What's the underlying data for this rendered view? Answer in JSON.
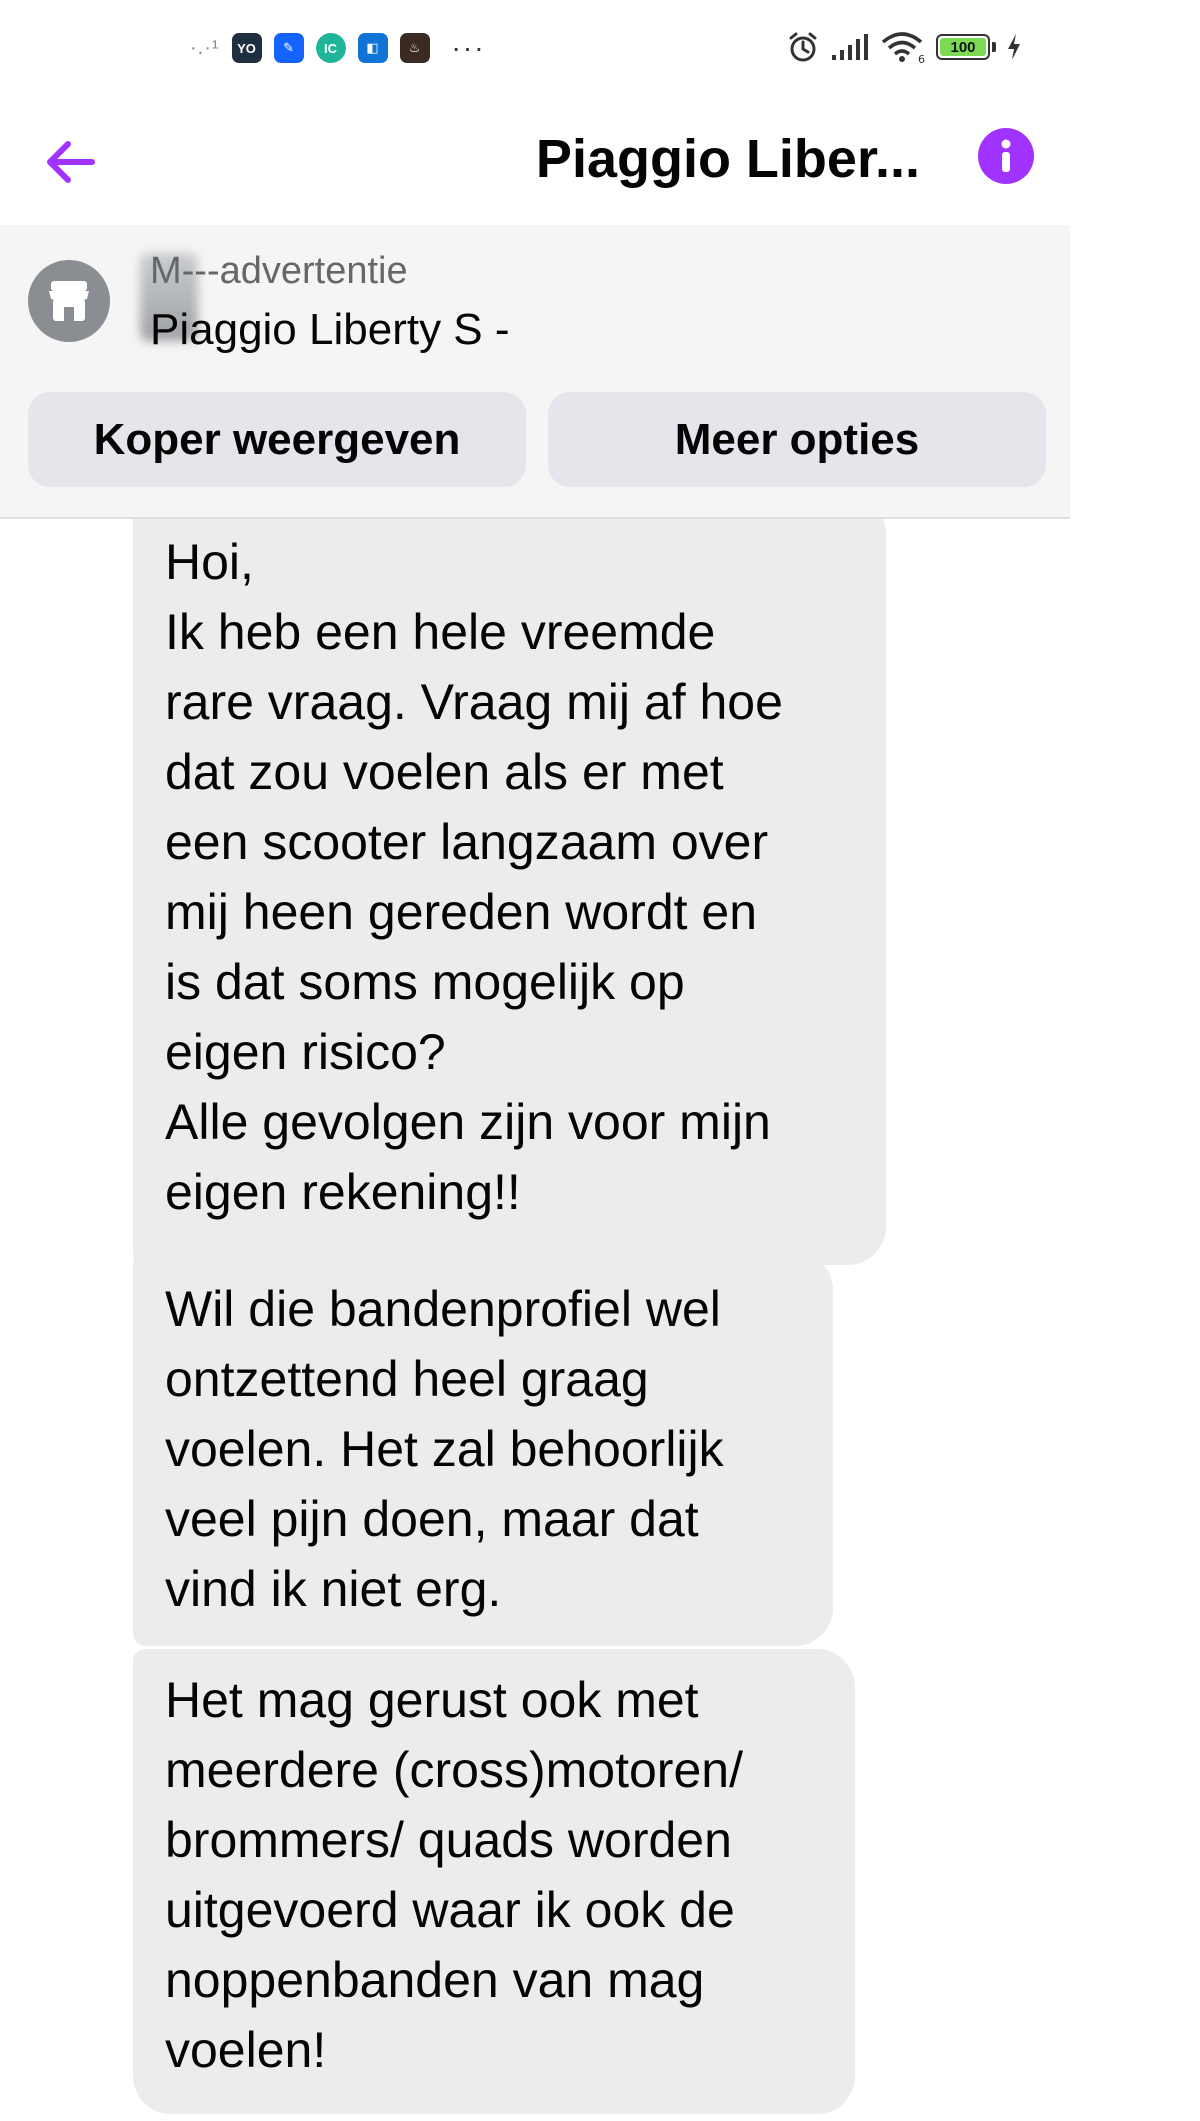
{
  "status_bar": {
    "signal_small": "·.·¹",
    "apps": [
      {
        "icon": "yo-app-icon",
        "label": "YO",
        "color": "#1f2f3f"
      },
      {
        "icon": "pen-app-icon",
        "label": "✎",
        "color": "#1463ff"
      },
      {
        "icon": "ic-app-icon",
        "label": "IC",
        "color": "#1fb59a"
      },
      {
        "icon": "outlook-app-icon",
        "label": "◧",
        "color": "#1073d6"
      },
      {
        "icon": "flame-app-icon",
        "label": "♨",
        "color": "#3a2a22"
      }
    ],
    "more": "···",
    "battery_level": 100,
    "battery_label": "100"
  },
  "header": {
    "title": "Piaggio Liber..."
  },
  "listing": {
    "subtitle": "M---advertentie",
    "name": "Piaggio Liberty S -",
    "view_buyer_label": "Koper weergeven",
    "more_options_label": "Meer opties"
  },
  "messages": [
    {
      "text": "Hoi,\nIk heb een hele vreemde\nrare vraag. Vraag mij af hoe\ndat zou voelen als er met\neen scooter langzaam over\nmij heen gereden wordt en\nis dat soms mogelijk op\neigen risico?\nAlle gevolgen zijn voor mijn\neigen rekening!!"
    },
    {
      "text": "Wil die bandenprofiel wel\nontzettend heel graag\nvoelen. Het zal behoorlijk\nveel pijn doen, maar dat\nvind ik niet erg."
    },
    {
      "text": "Het mag gerust ook met\nmeerdere (cross)motoren/\nbrommers/ quads worden\nuitgevoerd waar ik ook de\nnoppenbanden van mag\nvoelen!"
    }
  ],
  "colors": {
    "accent": "#a033ff",
    "bubble": "#ececec",
    "banner_bg": "#f5f5f5",
    "button_bg": "#e4e6eb"
  }
}
